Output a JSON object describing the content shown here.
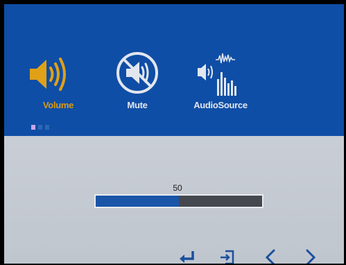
{
  "menu": {
    "items": [
      {
        "label": "Volume",
        "icon": "speaker-volume-icon",
        "selected": true
      },
      {
        "label": "Mute",
        "icon": "speaker-mute-icon",
        "selected": false
      },
      {
        "label": "AudioSource",
        "icon": "audio-source-icon",
        "selected": false
      }
    ],
    "page_count": 3,
    "active_page": 1
  },
  "slider": {
    "value_label": "50",
    "value": 50,
    "max": 100
  },
  "nav": {
    "icons": [
      "enter-icon",
      "exit-icon",
      "left-arrow-icon",
      "right-arrow-icon"
    ]
  },
  "colors": {
    "panel_blue": "#0f4ea6",
    "selected_orange": "#d99b14",
    "slider_fill": "#1b55a8",
    "slider_track": "#45484f",
    "bottom_gray": "#c6cbd2"
  }
}
